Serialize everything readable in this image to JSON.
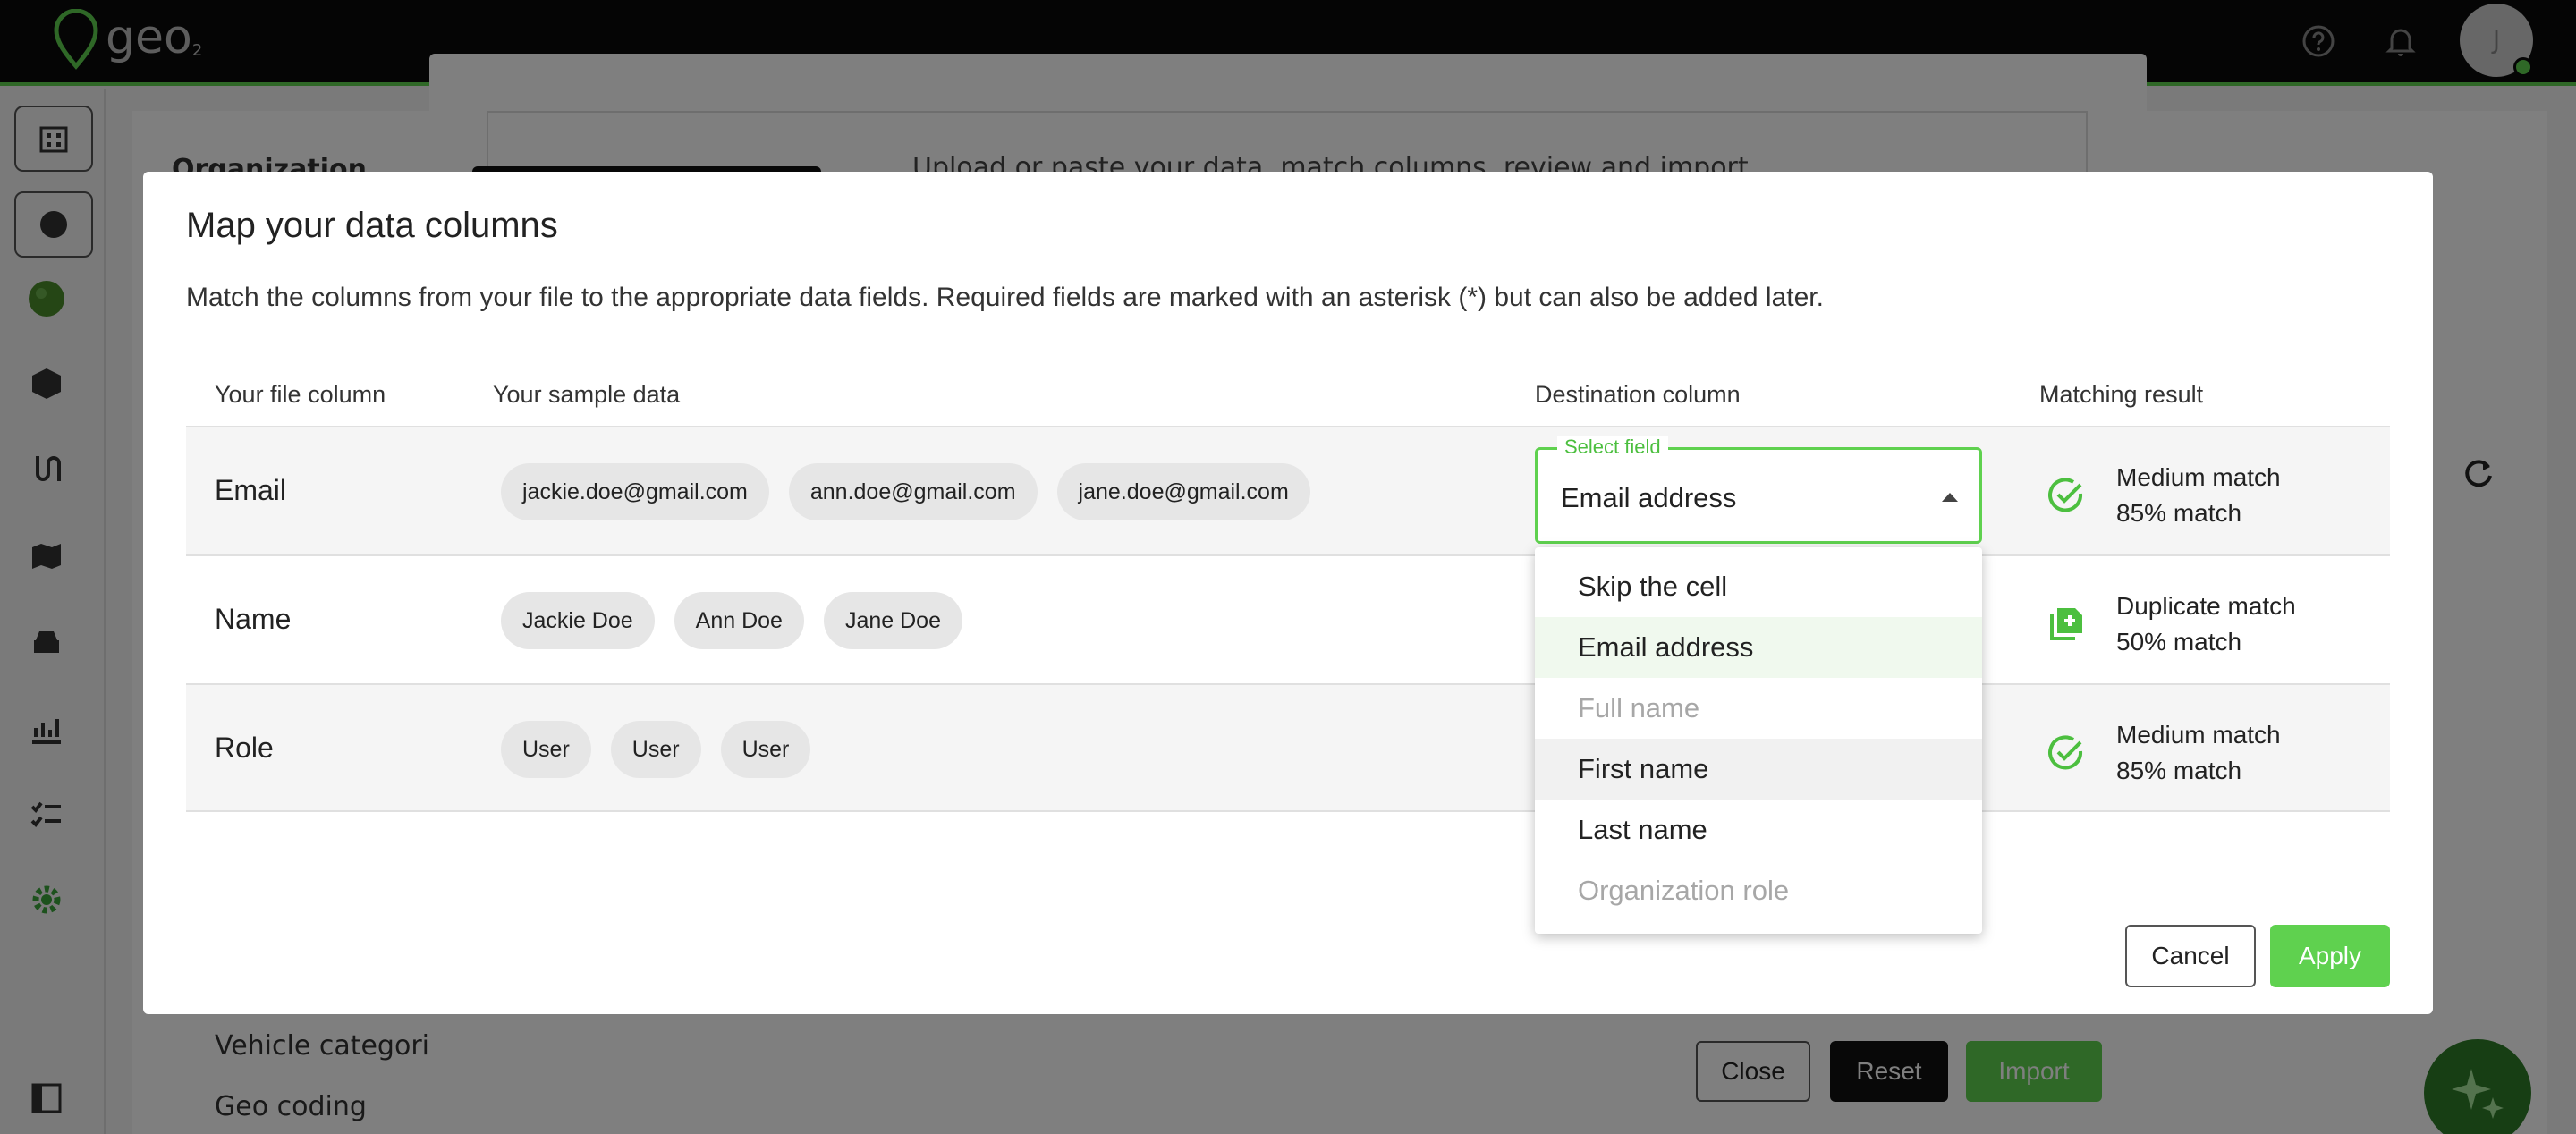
{
  "app": {
    "logo_text": "geo",
    "logo_sub": "2",
    "avatar_initial": "J",
    "brand_color": "#5fd14f"
  },
  "background": {
    "org_heading": "Organization",
    "side_links": [
      "Vehicle categories",
      "Geo coding"
    ],
    "import_text": "Upload or paste your data, match columns, review and import",
    "buttons": {
      "close": "Close",
      "reset": "Reset",
      "import": "Import"
    }
  },
  "modal": {
    "title": "Map your data columns",
    "description": "Match the columns from your file to the appropriate data fields. Required fields are marked with an asterisk (*) but can also be added later.",
    "headers": {
      "file_column": "Your file column",
      "sample_data": "Your sample data",
      "destination": "Destination column",
      "matching": "Matching result"
    },
    "rows": [
      {
        "name": "Email",
        "samples": [
          "jackie.doe@gmail.com",
          "ann.doe@gmail.com",
          "jane.doe@gmail.com"
        ],
        "match_title": "Medium match",
        "match_percent": "85% match",
        "match_icon": "check-circle-icon"
      },
      {
        "name": "Name",
        "samples": [
          "Jackie Doe",
          "Ann Doe",
          "Jane Doe"
        ],
        "match_title": "Duplicate match",
        "match_percent": "50% match",
        "match_icon": "duplicate-icon"
      },
      {
        "name": "Role",
        "samples": [
          "User",
          "User",
          "User"
        ],
        "match_title": "Medium match",
        "match_percent": "85% match",
        "match_icon": "check-circle-icon"
      }
    ],
    "select": {
      "label": "Select field",
      "value": "Email address"
    },
    "options": [
      {
        "label": "Skip the cell",
        "state": "normal"
      },
      {
        "label": "Email address",
        "state": "selected"
      },
      {
        "label": "Full name",
        "state": "disabled"
      },
      {
        "label": "First name",
        "state": "hover"
      },
      {
        "label": "Last name",
        "state": "normal"
      },
      {
        "label": "Organization role",
        "state": "disabled"
      }
    ],
    "cancel_label": "Cancel",
    "apply_label": "Apply"
  }
}
